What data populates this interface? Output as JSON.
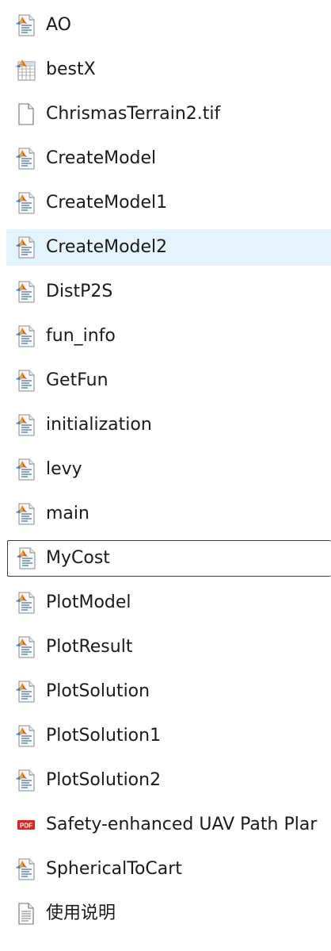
{
  "files": [
    {
      "name": "AO",
      "icon": "matlab-file-icon"
    },
    {
      "name": "bestX",
      "icon": "mat-data-file-icon"
    },
    {
      "name": "ChrismasTerrain2.tif",
      "icon": "blank-document-icon"
    },
    {
      "name": "CreateModel",
      "icon": "matlab-file-icon"
    },
    {
      "name": "CreateModel1",
      "icon": "matlab-file-icon"
    },
    {
      "name": "CreateModel2",
      "icon": "matlab-file-icon",
      "state": "hover"
    },
    {
      "name": "DistP2S",
      "icon": "matlab-file-icon"
    },
    {
      "name": "fun_info",
      "icon": "matlab-file-icon"
    },
    {
      "name": "GetFun",
      "icon": "matlab-file-icon"
    },
    {
      "name": "initialization",
      "icon": "matlab-file-icon"
    },
    {
      "name": "levy",
      "icon": "matlab-file-icon"
    },
    {
      "name": "main",
      "icon": "matlab-file-icon"
    },
    {
      "name": "MyCost",
      "icon": "matlab-file-icon",
      "state": "focused"
    },
    {
      "name": "PlotModel",
      "icon": "matlab-file-icon"
    },
    {
      "name": "PlotResult",
      "icon": "matlab-file-icon"
    },
    {
      "name": "PlotSolution",
      "icon": "matlab-file-icon"
    },
    {
      "name": "PlotSolution1",
      "icon": "matlab-file-icon"
    },
    {
      "name": "PlotSolution2",
      "icon": "matlab-file-icon"
    },
    {
      "name": "Safety-enhanced UAV Path Plar",
      "icon": "pdf-file-icon"
    },
    {
      "name": "SphericalToCart",
      "icon": "matlab-file-icon"
    },
    {
      "name": "使用说明",
      "icon": "text-document-icon"
    }
  ],
  "colors": {
    "hover_background": "#e5f3fe",
    "focus_border": "#3c3c3c",
    "pdf_red": "#d9281e"
  }
}
